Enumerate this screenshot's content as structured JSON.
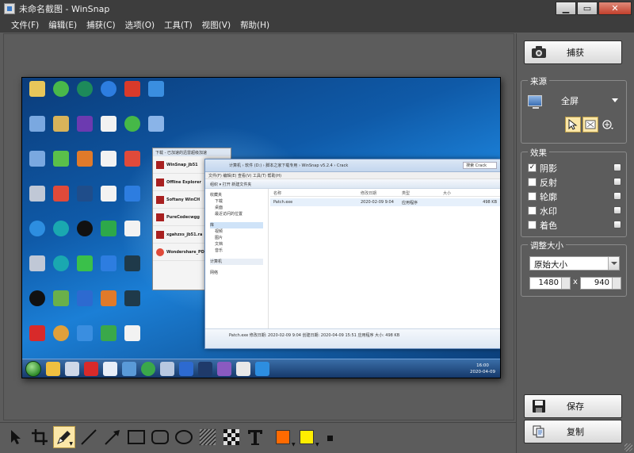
{
  "window": {
    "title": "未命名截图 - WinSnap"
  },
  "menu": [
    "文件(F)",
    "编辑(E)",
    "捕获(C)",
    "选项(O)",
    "工具(T)",
    "视图(V)",
    "帮助(H)"
  ],
  "actions": {
    "capture": "捕获",
    "save": "保存",
    "copy": "复制"
  },
  "source": {
    "title": "来源",
    "mode": "全屏"
  },
  "effects": {
    "title": "效果",
    "items": [
      {
        "label": "阴影",
        "checked": true
      },
      {
        "label": "反射",
        "checked": false
      },
      {
        "label": "轮廓",
        "checked": false
      },
      {
        "label": "水印",
        "checked": false
      },
      {
        "label": "着色",
        "checked": false
      }
    ]
  },
  "resize": {
    "title": "调整大小",
    "mode": "原始大小",
    "width": "1480",
    "height": "940",
    "separator": "x"
  },
  "colors": {
    "primary": "#ff6a00",
    "secondary": "#ffee00"
  },
  "snapshot": {
    "explorer": {
      "address": "计算机 › 软件 (D:) › 脚本之家下载专用 › WinSnap v5.2.4 › Crack",
      "search": "搜索 Crack",
      "menus": "文件(F)  编辑(E)  查看(V)  工具(T)  帮助(H)",
      "toolbar": "组织 ▾    打开    新建文件夹",
      "nav": [
        "收藏夹",
        "下载",
        "桌面",
        "最近访问的位置",
        "库",
        "视频",
        "图片",
        "文档",
        "音乐",
        "计算机",
        "网络"
      ],
      "columns": [
        "名称",
        "修改日期",
        "类型",
        "大小"
      ],
      "file": {
        "name": "Patch.exe",
        "date": "2020-02-09 9:04",
        "type": "应用程序",
        "size": "498 KB"
      },
      "details": "Patch.exe  修改日期: 2020-02-09 9:04   创建日期: 2020-04-09 15:51   应用程序   大小: 498 KB"
    },
    "downloads": {
      "header": "下载 - 已加速的迅雷超级加速",
      "items": [
        "WinSnap_jb51",
        "Offline Explorer",
        "Softany WinCH",
        "PureCodecwgg",
        "xgahzxs_jb51.ra",
        "Wondershare_PD"
      ]
    },
    "clock": {
      "time": "16:00",
      "date": "2020-04-09"
    }
  }
}
